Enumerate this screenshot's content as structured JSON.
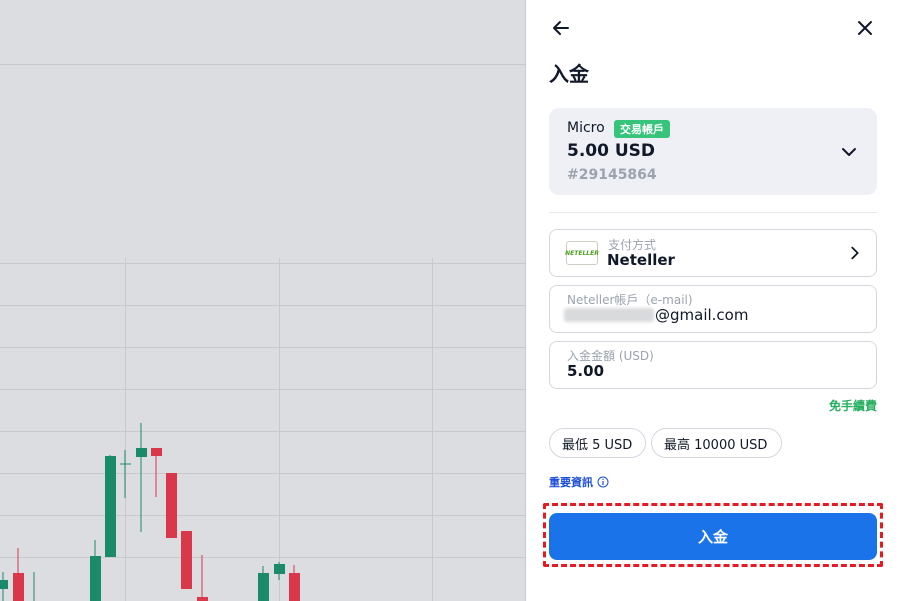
{
  "header": {
    "back_icon": "arrow-left-icon",
    "close_icon": "close-icon",
    "title": "入金"
  },
  "account": {
    "type": "Micro",
    "badge": "交易帳戶",
    "balance": "5.00 USD",
    "number": "#29145864",
    "chevron_icon": "chevron-down-icon"
  },
  "payment": {
    "label": "支付方式",
    "value": "Neteller",
    "logo_text": "NETELLER",
    "arrow_icon": "chevron-right-icon"
  },
  "email": {
    "label": "Neteller帳戶（e-mail)",
    "value_suffix": "@gmail.com"
  },
  "amount": {
    "label": "入金金額 (USD)",
    "value": "5.00"
  },
  "fee_note": "免手續費",
  "limits": {
    "min": "最低 5 USD",
    "max": "最高 10000 USD"
  },
  "info_link": "重要資訊",
  "deposit_button": "入金",
  "colors": {
    "accent": "#1a73e8",
    "badge_green": "#35c47a",
    "fee_green": "#27ae60",
    "candle_up": "#1a8a6a",
    "candle_down": "#d9384a",
    "highlight_red": "#e31b23"
  }
}
